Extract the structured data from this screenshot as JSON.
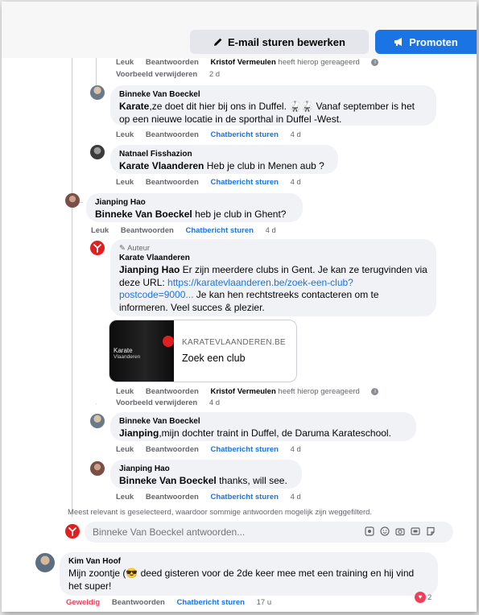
{
  "toolbar": {
    "edit_email_label": "E-mail sturen bewerken",
    "promote_label": "Promoten",
    "edit_icon": "pencil-icon",
    "promote_icon": "megaphone-icon"
  },
  "labels": {
    "like": "Leuk",
    "reply": "Beantwoorden",
    "chat": "Chatbericht sturen",
    "remove_preview": "Voorbeeld verwijderen",
    "seen_by_suffix": "heeft hierop gereageerd",
    "author_badge": "Auteur"
  },
  "thread": {
    "top_actions": {
      "seen_by": "Kristof Vermeulen",
      "time": "2 d"
    },
    "comments": [
      {
        "author": "Binneke Van Boeckel",
        "mention": "Karate",
        "text": ",ze doet dit hier bij ons in Duffel. 🥋🥋 Vanaf september is het op een nieuwe locatie in de sporthal in Duffel -West.",
        "time": "4 d"
      },
      {
        "author": "Natnael Fisshazion",
        "mention": "Karate Vlaanderen",
        "text": " Heb je club in Menen aub ?",
        "time": "4 d"
      },
      {
        "author": "Jianping Hao",
        "mention": "Binneke Van Boeckel",
        "text": " heb je club in Ghent?",
        "time": "4 d"
      },
      {
        "author": "Karate Vlaanderen",
        "mention": "Jianping Hao",
        "text": " Er zijn meerdere clubs in Gent. Je kan ze terugvinden via deze URL: ",
        "link": "https://karatevlaanderen.be/zoek-een-club?postcode=9000...",
        "text_after": " Je kan hen rechtstreeks contacteren om te informeren. Veel succes & plezier.",
        "seen_by": "Kristof Vermeulen",
        "time": "4 d"
      },
      {
        "author": "Binneke Van Boeckel",
        "mention": "Jianping",
        "text": ",mijn dochter traint in Duffel, de Daruma Karateschool.",
        "time": "4 d"
      },
      {
        "author": "Jianping Hao",
        "mention": "Binneke Van Boeckel",
        "text": " thanks,  will see.",
        "time": "4 d"
      }
    ],
    "link_card": {
      "domain": "KARATEVLAANDEREN.BE",
      "title": "Zoek een club",
      "logo_line1": "Karate",
      "logo_line2": "Vlaanderen"
    },
    "filter_note": "Meest relevant is geselecteerd, waardoor sommige antwoorden mogelijk zijn weggefilterd.",
    "reply_placeholder": "Binneke Van Boeckel antwoorden..."
  },
  "bottom_comment": {
    "author": "Kim Van Hoof",
    "text": "Mijn zoontje (😎 deed gisteren voor de 2de keer mee met een training en hij vind het super!",
    "actions": {
      "like": "Geweldig",
      "reply": "Beantwoorden",
      "chat": "Chatbericht sturen",
      "time": "17 u"
    },
    "reactions_count": "2"
  },
  "colors": {
    "accent": "#1b74e4",
    "bubble": "#f0f2f5",
    "brand_red": "#e02020",
    "heart": "#f33e58"
  }
}
